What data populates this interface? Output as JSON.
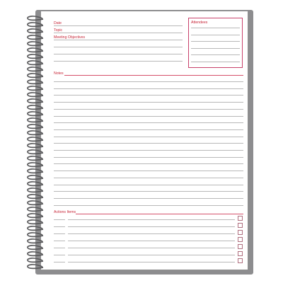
{
  "notebook": {
    "fields": {
      "date_label": "Date",
      "topic_label": "Topic",
      "objectives_label": "Meeting Objectives"
    },
    "attendees": {
      "label": "Attendees"
    },
    "notes": {
      "label": "Notes"
    },
    "actions": {
      "label": "Actions Items"
    },
    "colors": {
      "accent": "#c8283a",
      "rule": "#b8b8b8",
      "cover": "#8d8d8f"
    }
  }
}
